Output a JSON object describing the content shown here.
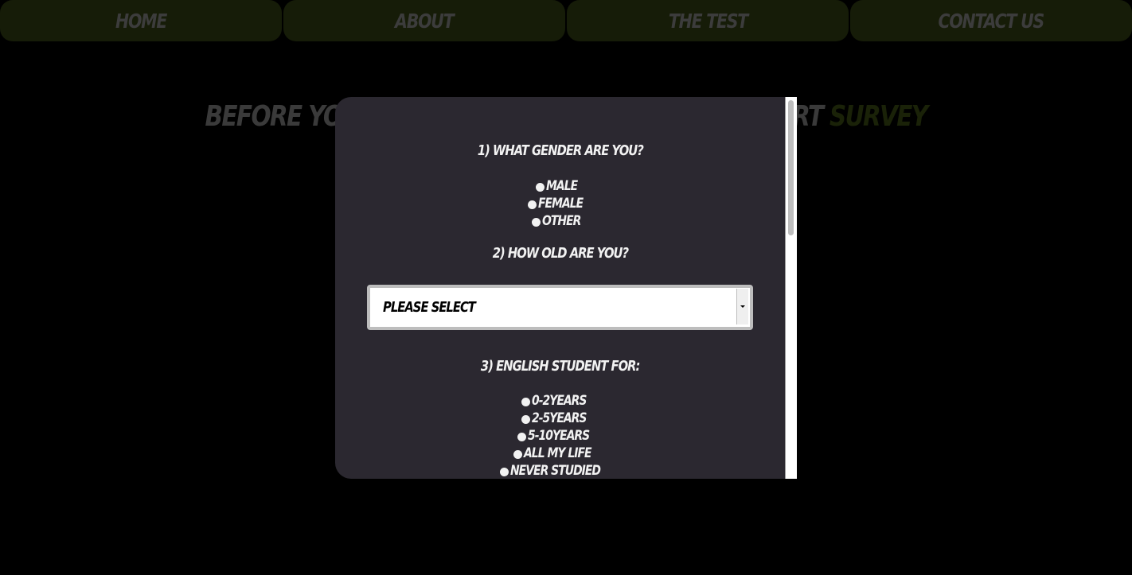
{
  "nav": {
    "items": [
      {
        "label": "HOME"
      },
      {
        "label": "ABOUT"
      },
      {
        "label": "THE TEST"
      },
      {
        "label": "CONTACT US"
      }
    ]
  },
  "heading": {
    "text_left": "BEFORE YO",
    "text_right": "RT ",
    "accent": "SURVEY"
  },
  "survey": {
    "q1": {
      "label": "1) WHAT GENDER ARE YOU?",
      "options": [
        "MALE",
        "FEMALE",
        "OTHER"
      ]
    },
    "q2": {
      "label": "2) HOW OLD ARE YOU?",
      "select_value": "PLEASE SELECT"
    },
    "q3": {
      "label": "3) ENGLISH STUDENT FOR:",
      "options": [
        "0-2YEARS",
        "2-5YEARS",
        "5-10YEARS",
        "ALL MY LIFE",
        "NEVER STUDIED"
      ]
    }
  },
  "colors": {
    "background": "#000000",
    "nav_bg": "#161c08",
    "modal_bg": "#2b2830",
    "text_light": "#f2f2f2",
    "accent": "#1a2208"
  },
  "icons": {
    "radio": "radio-circle",
    "select_caret": "chevron-down-icon"
  }
}
